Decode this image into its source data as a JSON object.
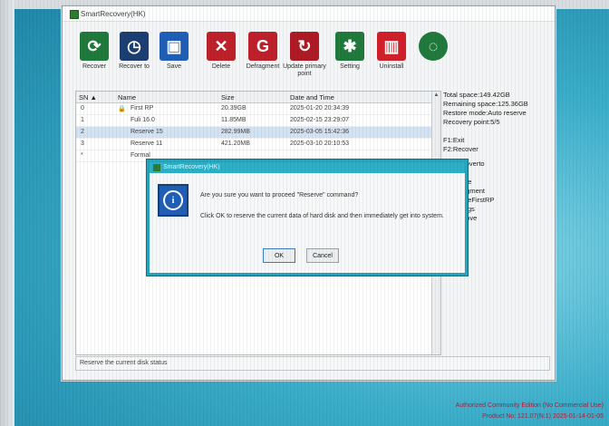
{
  "window": {
    "title": "SmartRecovery(HK)"
  },
  "toolbar": [
    {
      "label": "Recover",
      "icon": "recover-icon",
      "color": "#1f7a3c",
      "glyph": "⟳"
    },
    {
      "label": "Recover to",
      "icon": "recover-to-icon",
      "color": "#1c3f73",
      "glyph": "◷"
    },
    {
      "label": "Save",
      "icon": "save-icon",
      "color": "#1f5fb8",
      "glyph": "▣"
    },
    {
      "label": "Delete",
      "icon": "delete-icon",
      "color": "#c0202a",
      "glyph": "✕"
    },
    {
      "label": "Defragment",
      "icon": "defragment-icon",
      "color": "#c0202a",
      "glyph": "G"
    },
    {
      "label": "Update primary point",
      "icon": "update-primary-point-icon",
      "color": "#b01a24",
      "glyph": "↻"
    },
    {
      "label": "Setting",
      "icon": "setting-icon",
      "color": "#1f7a3c",
      "glyph": "✱"
    },
    {
      "label": "Uninstall",
      "icon": "uninstall-icon",
      "color": "#d21f2a",
      "glyph": "🗑"
    },
    {
      "label": "",
      "icon": "more-icon",
      "color": "#1f7a3c",
      "glyph": "◌"
    }
  ],
  "list": {
    "headers": {
      "sn": "SN ▲",
      "name": "Name",
      "size": "Size",
      "datetime": "Date and Time"
    },
    "rows": [
      {
        "sn": "0",
        "name": "First RP",
        "size": "20.39GB",
        "datetime": "2025-01-20 20:34:39"
      },
      {
        "sn": "1",
        "name": "Fuli 16.0",
        "size": "11.85MB",
        "datetime": "2025-02-15 23:29:07"
      },
      {
        "sn": "2",
        "name": "Reserve 15",
        "size": "282.99MB",
        "datetime": "2025-03-05 15:42:36"
      },
      {
        "sn": "3",
        "name": "Reserve 11",
        "size": "421.20MB",
        "datetime": "2025-03-10 20:10:53"
      },
      {
        "sn": "*",
        "name": "Formal",
        "size": "",
        "datetime": ""
      }
    ]
  },
  "info": {
    "total_space": "Total space:149.42GB",
    "remaining_space": "Remaining space:125.36GB",
    "restore_mode": "Restore mode:Auto reserve",
    "recovery_point": "Recovery point:5/5",
    "hotkeys": [
      "F1:Exit",
      "F2:Recover"
    ],
    "partial_labels": [
      "coverto",
      "e",
      "ete",
      "agment",
      "ateFirstRP",
      "ings",
      "nove"
    ]
  },
  "status": {
    "text": "Reserve the current disk status"
  },
  "dialog": {
    "title": "SmartRecovery(HK)",
    "question": "Are you sure you want to proceed \"Reserve\" command?",
    "message": "Click OK to reserve the current data of hard disk and then immediately get into system.",
    "ok_label": "OK",
    "cancel_label": "Cancel"
  },
  "watermark": {
    "line1": "Authorized Community Edition (No Commercial Use)",
    "line2": "Product No: 121.07(N:1) 2025-01-14-01-05"
  }
}
